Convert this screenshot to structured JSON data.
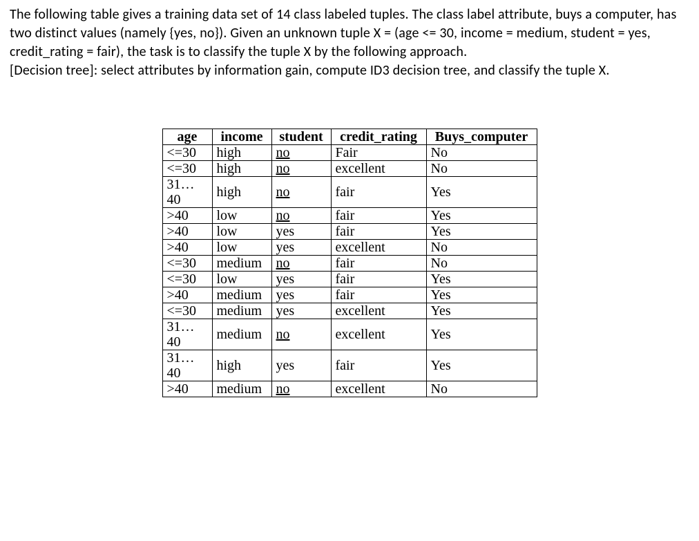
{
  "text": {
    "para": "The following table gives a training data set of 14 class labeled tuples. The class label attribute, buys a computer, has two distinct values (namely {yes, no}). Given an unknown tuple X = (age <= 30, income = medium, student = yes, credit_rating = fair), the task is to classify the tuple X by the following approach.",
    "dt": "[Decision tree]: select attributes by information gain, compute ID3 decision tree, and classify the tuple X."
  },
  "table": {
    "headers": {
      "age": "age",
      "income": "income",
      "student": "student",
      "credit_rating": "credit_rating",
      "buys_computer": "Buys_computer"
    },
    "rows": [
      {
        "age": "<=30",
        "income": "high",
        "student": "no",
        "credit_rating": "Fair",
        "buys_computer": "No"
      },
      {
        "age": "<=30",
        "income": "high",
        "student": "no",
        "credit_rating": "excellent",
        "buys_computer": "No"
      },
      {
        "age": "31…40",
        "income": "high",
        "student": "no",
        "credit_rating": "fair",
        "buys_computer": "Yes"
      },
      {
        "age": ">40",
        "income": "low",
        "student": "no",
        "credit_rating": "fair",
        "buys_computer": "Yes"
      },
      {
        "age": ">40",
        "income": "low",
        "student": "yes",
        "credit_rating": "fair",
        "buys_computer": "Yes"
      },
      {
        "age": ">40",
        "income": "low",
        "student": "yes",
        "credit_rating": "excellent",
        "buys_computer": "No"
      },
      {
        "age": "<=30",
        "income": "medium",
        "student": "no",
        "credit_rating": "fair",
        "buys_computer": "No"
      },
      {
        "age": "<=30",
        "income": "low",
        "student": "yes",
        "credit_rating": "fair",
        "buys_computer": "Yes"
      },
      {
        "age": ">40",
        "income": "medium",
        "student": "yes",
        "credit_rating": "fair",
        "buys_computer": "Yes"
      },
      {
        "age": "<=30",
        "income": "medium",
        "student": "yes",
        "credit_rating": "excellent",
        "buys_computer": "Yes"
      },
      {
        "age": "31…40",
        "income": "medium",
        "student": "no",
        "credit_rating": "excellent",
        "buys_computer": "Yes"
      },
      {
        "age": "31…40",
        "income": "high",
        "student": "yes",
        "credit_rating": "fair",
        "buys_computer": "Yes"
      },
      {
        "age": ">40",
        "income": "medium",
        "student": "no",
        "credit_rating": "excellent",
        "buys_computer": "No"
      }
    ]
  }
}
